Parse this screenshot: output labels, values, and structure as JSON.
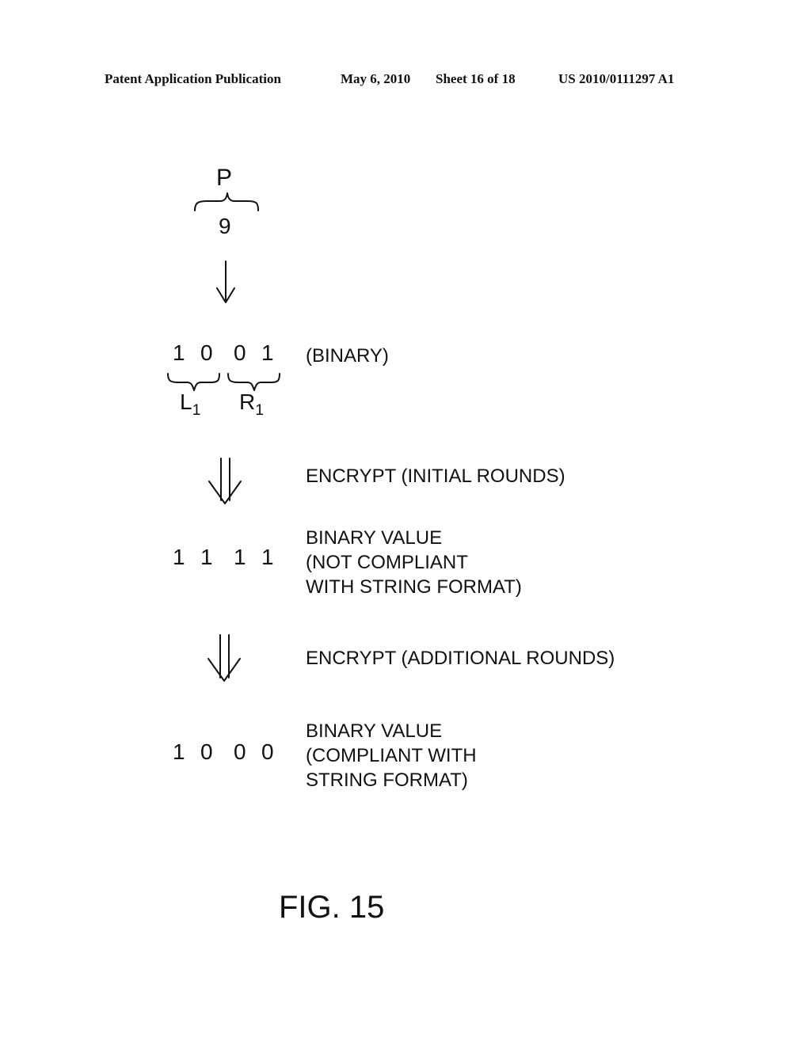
{
  "header": {
    "publication": "Patent Application Publication",
    "date": "May 6, 2010",
    "sheet": "Sheet 16 of 18",
    "number": "US 2010/0111297 A1"
  },
  "figure": {
    "plaintext_symbol": "P",
    "plaintext_value": "9",
    "binary_digits": [
      "1",
      "0",
      "0",
      "1"
    ],
    "binary_label": "(BINARY)",
    "left_half": {
      "letter": "L",
      "subscript": "1"
    },
    "right_half": {
      "letter": "R",
      "subscript": "1"
    },
    "step1_label": "ENCRYPT (INITIAL ROUNDS)",
    "intermediate_digits": [
      "1",
      "1",
      "1",
      "1"
    ],
    "intermediate_label": [
      "BINARY VALUE",
      "(NOT COMPLIANT",
      "WITH STRING FORMAT)"
    ],
    "step2_label": "ENCRYPT (ADDITIONAL ROUNDS)",
    "final_digits": [
      "1",
      "0",
      "0",
      "0"
    ],
    "final_label": [
      "BINARY VALUE",
      "(COMPLIANT WITH",
      "STRING FORMAT)"
    ],
    "caption": "FIG. 15"
  }
}
